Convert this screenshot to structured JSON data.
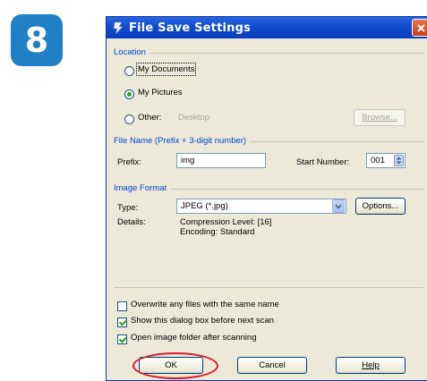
{
  "step_badge": "8",
  "dialog": {
    "title": "File Save Settings",
    "location": {
      "section_label": "Location",
      "options": [
        {
          "label": "My Documents",
          "selected": false
        },
        {
          "label": "My Pictures",
          "selected": true
        },
        {
          "label": "Other:",
          "selected": false
        }
      ],
      "other_path": "Desktop",
      "browse_label": "Browse..."
    },
    "file_name": {
      "section_label": "File Name (Prefix + 3-digit number)",
      "prefix_label": "Prefix:",
      "prefix_value": "img",
      "start_number_label": "Start Number:",
      "start_number_value": "001"
    },
    "image_format": {
      "section_label": "Image Format",
      "type_label": "Type:",
      "type_value": "JPEG (*.jpg)",
      "options_label": "Options...",
      "details_label": "Details:",
      "details_line1": "Compression Level: [16]",
      "details_line2": "Encoding: Standard"
    },
    "checkboxes": [
      {
        "label": "Overwrite any files with the same name",
        "checked": false
      },
      {
        "label": "Show this dialog box before next scan",
        "checked": true
      },
      {
        "label": "Open image folder after scanning",
        "checked": true
      }
    ],
    "buttons": {
      "ok": "OK",
      "cancel": "Cancel",
      "help": "Help"
    }
  },
  "colors": {
    "badge": "#1f80c6",
    "titlebar": "#0f4bcf",
    "highlight": "#d9182d",
    "section_label": "#0046d5"
  }
}
